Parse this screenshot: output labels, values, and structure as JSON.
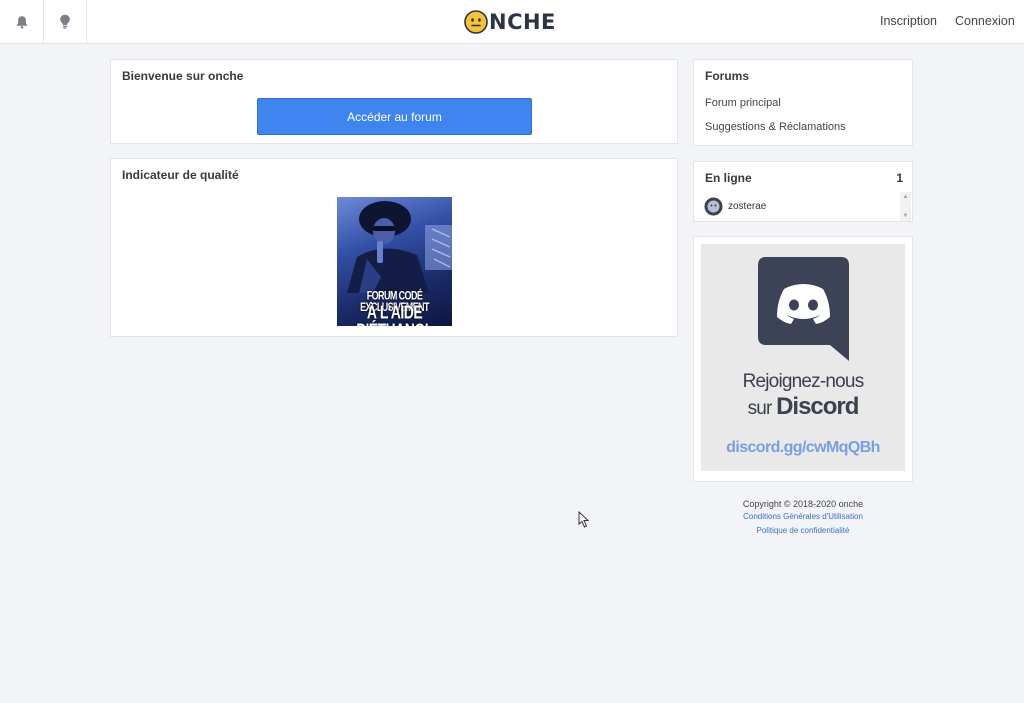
{
  "header": {
    "logo_text": "NCHE",
    "signup_label": "Inscription",
    "login_label": "Connexion"
  },
  "welcome": {
    "title": "Bienvenue sur onche",
    "button_label": "Accéder au forum"
  },
  "quality": {
    "title": "Indicateur de qualité",
    "caption_line1": "FORUM CODÉ EXCLUSIVEMENT",
    "caption_line2": "À L'AIDE D'ÉTHANOL"
  },
  "forums": {
    "title": "Forums",
    "links": [
      "Forum principal",
      "Suggestions & Réclamations"
    ]
  },
  "online": {
    "title": "En ligne",
    "count": "1",
    "users": [
      "zosterae"
    ]
  },
  "discord": {
    "line1": "Rejoignez-nous",
    "line2_prefix": "sur ",
    "line2_brand": "Discord",
    "url": "discord.gg/cwMqQBh"
  },
  "footer": {
    "copyright": "Copyright © 2018-2020 onche",
    "links": [
      "Conditions Générales d'Utilisation",
      "Politique de confidentialité"
    ]
  },
  "colors": {
    "accent_button": "#3f85f0",
    "page_background": "#f3f4f7",
    "logo_dark": "#2b3444",
    "discord_dark": "#3c4150",
    "discord_link": "#7b9ee0",
    "footer_link": "#3d6fc4"
  },
  "icons": [
    "bell-icon",
    "lightbulb-icon",
    "smiley-logo-icon",
    "user-avatar-icon",
    "discord-logo-icon",
    "cursor-icon"
  ]
}
